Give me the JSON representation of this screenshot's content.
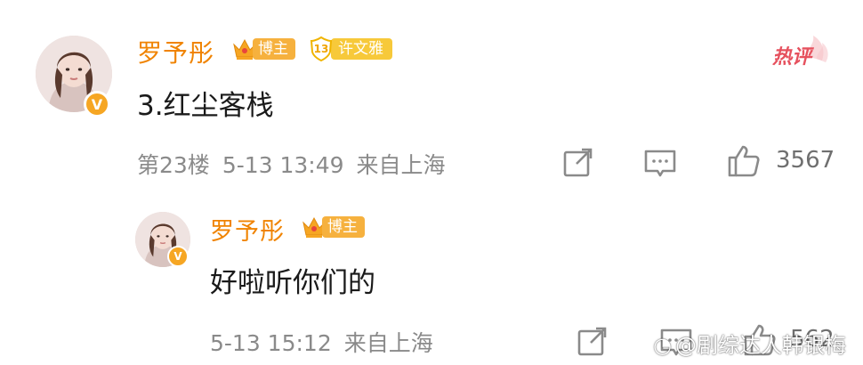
{
  "comment": {
    "username": "罗予彤",
    "blogger_badge": "博主",
    "fan_badge_level": "13",
    "fan_badge_name": "许文雅",
    "hot_label": "热评",
    "text": "3.红尘客栈",
    "floor": "第23楼",
    "date": "5-13 13:49",
    "location": "来自上海",
    "like_count": "3567"
  },
  "reply": {
    "username": "罗予彤",
    "blogger_badge": "博主",
    "text": "好啦听你们的",
    "date": "5-13 15:12",
    "location": "来自上海",
    "like_count": "562"
  },
  "watermark": "@剧综达人韩银梅",
  "colors": {
    "username": "#f08300",
    "hot": "#e6515e",
    "meta": "#8a8a8a",
    "badge": "#f6b13e"
  }
}
